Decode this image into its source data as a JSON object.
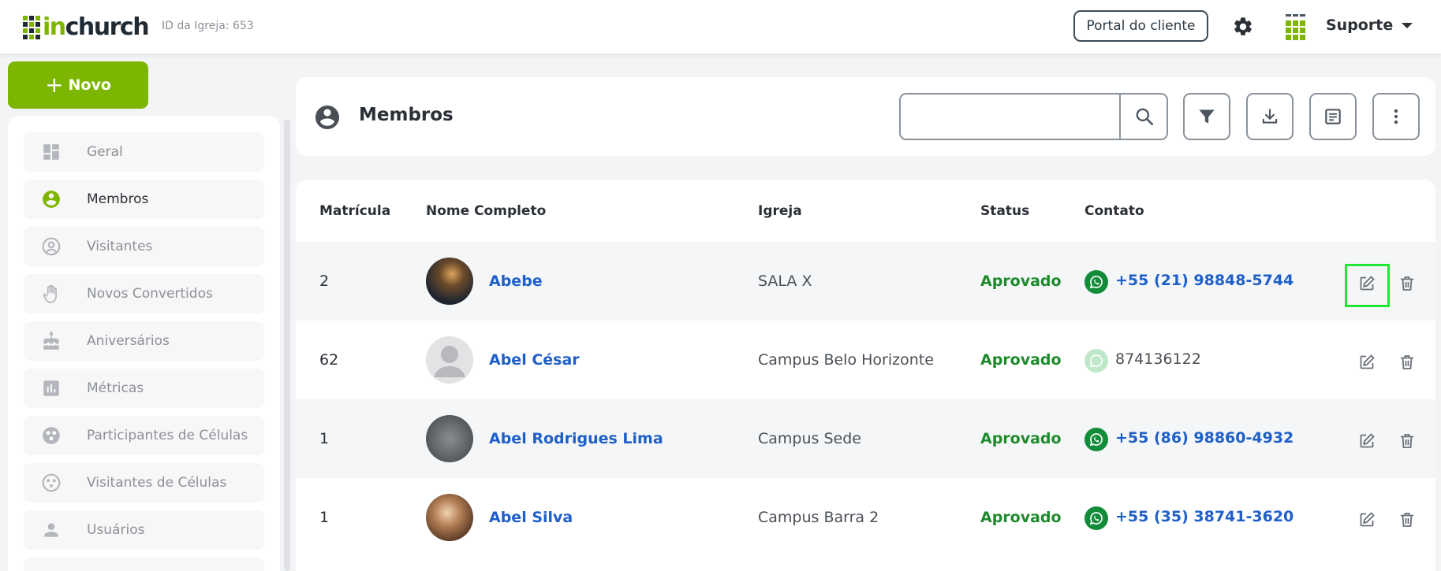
{
  "header": {
    "logo_prefix": "in",
    "logo_suffix": "church",
    "church_id": "ID da Igreja: 653",
    "portal_label": "Portal do cliente",
    "user_name": "Suporte",
    "accent_color": "#7db600"
  },
  "sidebar": {
    "new_label": "Novo",
    "items": [
      {
        "label": "Geral",
        "icon": "dashboard-icon"
      },
      {
        "label": "Membros",
        "icon": "user-circle-icon"
      },
      {
        "label": "Visitantes",
        "icon": "user-outline-icon"
      },
      {
        "label": "Novos Convertidos",
        "icon": "hand-icon"
      },
      {
        "label": "Aniversários",
        "icon": "cake-icon"
      },
      {
        "label": "Métricas",
        "icon": "bar-chart-icon"
      },
      {
        "label": "Participantes de Células",
        "icon": "cell-group-icon"
      },
      {
        "label": "Visitantes de Células",
        "icon": "cell-visitors-icon"
      },
      {
        "label": "Usuários",
        "icon": "person-icon"
      }
    ],
    "active_index": 1
  },
  "main": {
    "title": "Membros",
    "search": {
      "value": "",
      "placeholder": ""
    },
    "columns": [
      "Matrícula",
      "Nome Completo",
      "Igreja",
      "Status",
      "Contato"
    ],
    "rows": [
      {
        "matricula": "2",
        "nome": "Abebe",
        "igreja": "SALA X",
        "status": "Aprovado",
        "contato": "+55 (21) 98848-5744",
        "contato_link": true
      },
      {
        "matricula": "62",
        "nome": "Abel César",
        "igreja": "Campus Belo Horizonte",
        "status": "Aprovado",
        "contato": "874136122",
        "contato_link": false
      },
      {
        "matricula": "1",
        "nome": "Abel Rodrigues Lima",
        "igreja": "Campus Sede",
        "status": "Aprovado",
        "contato": "+55 (86) 98860-4932",
        "contato_link": true
      },
      {
        "matricula": "1",
        "nome": "Abel Silva",
        "igreja": "Campus Barra 2",
        "status": "Aprovado",
        "contato": "+55 (35) 38741-3620",
        "contato_link": true
      }
    ]
  }
}
